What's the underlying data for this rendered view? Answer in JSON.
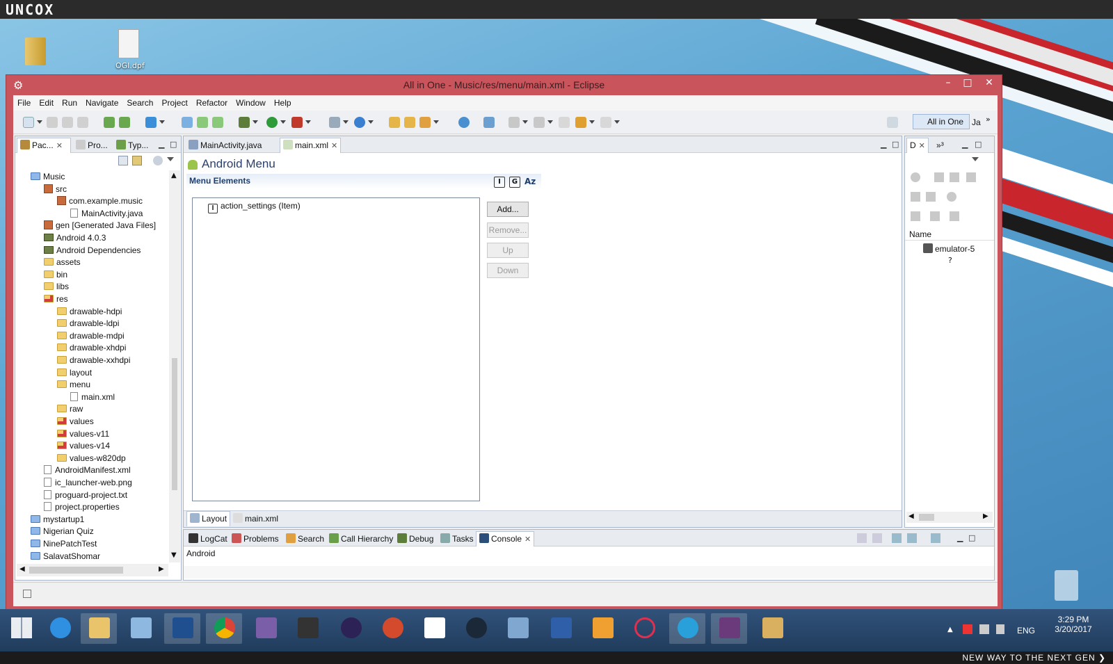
{
  "brand": "UNCOX",
  "slogan": "NEW WAY TO THE NEXT GEN ❯",
  "desktop": {
    "icons": [
      {
        "name": "folder-icon",
        "label": ""
      },
      {
        "name": "document-icon",
        "label": "OGI.dpf"
      }
    ]
  },
  "window": {
    "title": "All in One - Music/res/menu/main.xml - Eclipse",
    "minimize": "–",
    "maximize": "□",
    "close": "✕"
  },
  "menubar": [
    "File",
    "Edit",
    "Run",
    "Navigate",
    "Search",
    "Project",
    "Refactor",
    "Window",
    "Help"
  ],
  "perspective": {
    "label": "All in One",
    "next": "Ja"
  },
  "left_panel": {
    "tabs": [
      "Pac...",
      "Pro...",
      "Typ..."
    ],
    "tree": [
      {
        "label": "Music",
        "indent": 0,
        "icon": "project"
      },
      {
        "label": "src",
        "indent": 1,
        "icon": "src"
      },
      {
        "label": "com.example.music",
        "indent": 2,
        "icon": "package"
      },
      {
        "label": "MainActivity.java",
        "indent": 3,
        "icon": "java"
      },
      {
        "label": "gen [Generated Java Files]",
        "indent": 1,
        "icon": "src"
      },
      {
        "label": "Android 4.0.3",
        "indent": 1,
        "icon": "lib"
      },
      {
        "label": "Android Dependencies",
        "indent": 1,
        "icon": "lib"
      },
      {
        "label": "assets",
        "indent": 1,
        "icon": "folder"
      },
      {
        "label": "bin",
        "indent": 1,
        "icon": "folder"
      },
      {
        "label": "libs",
        "indent": 1,
        "icon": "folder"
      },
      {
        "label": "res",
        "indent": 1,
        "icon": "redfolder"
      },
      {
        "label": "drawable-hdpi",
        "indent": 2,
        "icon": "folder"
      },
      {
        "label": "drawable-ldpi",
        "indent": 2,
        "icon": "folder"
      },
      {
        "label": "drawable-mdpi",
        "indent": 2,
        "icon": "folder"
      },
      {
        "label": "drawable-xhdpi",
        "indent": 2,
        "icon": "folder"
      },
      {
        "label": "drawable-xxhdpi",
        "indent": 2,
        "icon": "folder"
      },
      {
        "label": "layout",
        "indent": 2,
        "icon": "folder"
      },
      {
        "label": "menu",
        "indent": 2,
        "icon": "folder"
      },
      {
        "label": "main.xml",
        "indent": 3,
        "icon": "file"
      },
      {
        "label": "raw",
        "indent": 2,
        "icon": "folder"
      },
      {
        "label": "values",
        "indent": 2,
        "icon": "redfolder"
      },
      {
        "label": "values-v11",
        "indent": 2,
        "icon": "redfolder"
      },
      {
        "label": "values-v14",
        "indent": 2,
        "icon": "redfolder"
      },
      {
        "label": "values-w820dp",
        "indent": 2,
        "icon": "folder"
      },
      {
        "label": "AndroidManifest.xml",
        "indent": 1,
        "icon": "file"
      },
      {
        "label": "ic_launcher-web.png",
        "indent": 1,
        "icon": "png"
      },
      {
        "label": "proguard-project.txt",
        "indent": 1,
        "icon": "file"
      },
      {
        "label": "project.properties",
        "indent": 1,
        "icon": "file"
      },
      {
        "label": "mystartup1",
        "indent": 0,
        "icon": "bluefolder"
      },
      {
        "label": "Nigerian Quiz",
        "indent": 0,
        "icon": "bluefolder"
      },
      {
        "label": "NinePatchTest",
        "indent": 0,
        "icon": "bluefolder"
      },
      {
        "label": "SalavatShomar",
        "indent": 0,
        "icon": "bluefolder"
      }
    ]
  },
  "editor": {
    "tabs": [
      "MainActivity.java",
      "main.xml"
    ],
    "title": "Android Menu",
    "section": "Menu Elements",
    "header_icons": [
      "I",
      "G",
      "Az"
    ],
    "items": [
      {
        "badge": "I",
        "label": "action_settings (Item)"
      }
    ],
    "buttons": {
      "add": "Add...",
      "remove": "Remove...",
      "up": "Up",
      "down": "Down"
    },
    "bottom_tabs": [
      "Layout",
      "main.xml"
    ]
  },
  "right_panel": {
    "tabs": [
      "D",
      "³"
    ],
    "column": "Name",
    "rows": [
      {
        "label": "emulator-5",
        "sub": "?"
      }
    ]
  },
  "console": {
    "tabs": [
      "LogCat",
      "Problems",
      "Search",
      "Call Hierarchy",
      "Debug",
      "Tasks",
      "Console"
    ],
    "content": "Android"
  },
  "tray": {
    "lang": "ENG",
    "time": "3:29 PM",
    "date": "3/20/2017"
  }
}
